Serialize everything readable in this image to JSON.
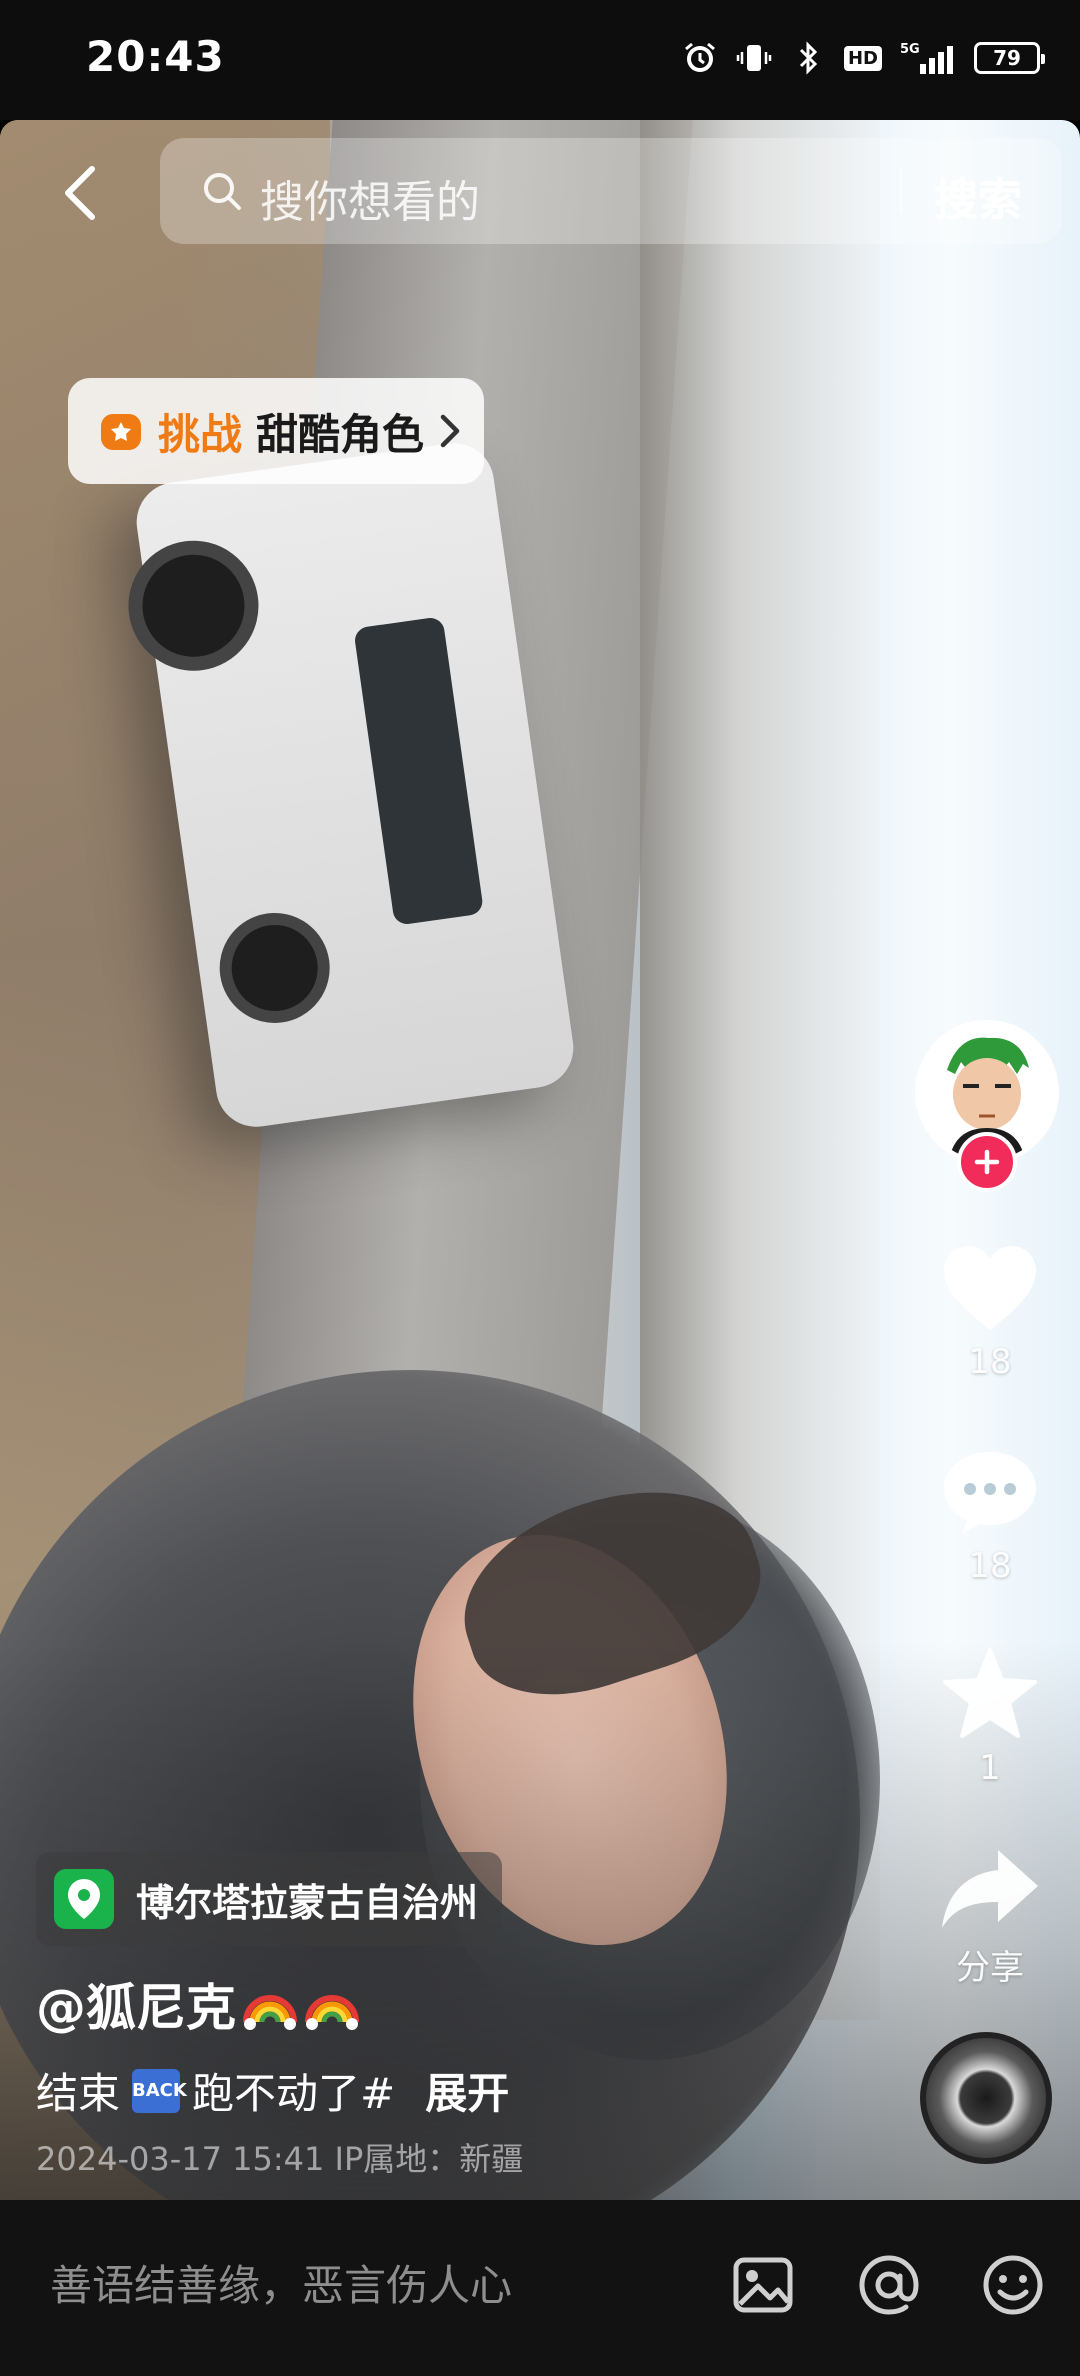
{
  "status_bar": {
    "time": "20:43",
    "battery": "79",
    "network": "5G",
    "hd_badge": "HD",
    "icons": [
      "alarm-icon",
      "vibrate-icon",
      "bluetooth-icon",
      "hd-icon",
      "signal-icon",
      "battery-icon"
    ]
  },
  "search": {
    "placeholder": "搜你想看的",
    "button": "搜索"
  },
  "challenge": {
    "tag": "挑战",
    "name": "甜酷角色"
  },
  "actions": {
    "like_count": "18",
    "comment_count": "18",
    "favorite_count": "1",
    "share_label": "分享"
  },
  "post": {
    "location": "博尔塔拉蒙古自治州",
    "author": "@狐尼克",
    "description_before": "结束",
    "description_back_label": "BACK",
    "description_after": "跑不动了#",
    "expand": "展开",
    "meta": "2024-03-17 15:41  IP属地：新疆"
  },
  "comment_bar": {
    "placeholder": "善语结善缘，恶言伤人心"
  },
  "colors": {
    "accent_orange": "#f07a13",
    "follow_red": "#f22c5a",
    "location_green": "#19b24b"
  }
}
